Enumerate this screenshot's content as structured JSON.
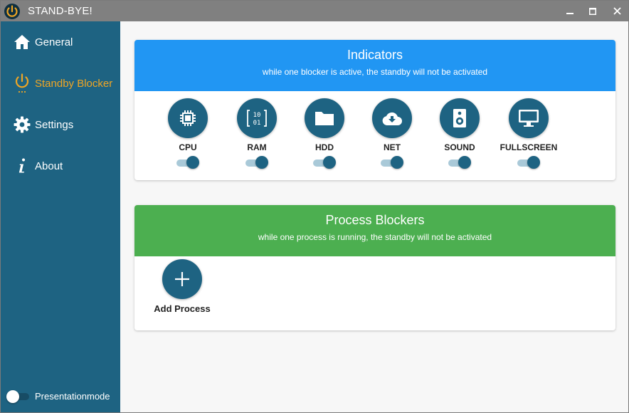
{
  "window": {
    "title": "STAND-BYE!"
  },
  "sidebar": {
    "items": [
      {
        "label": "General",
        "icon": "home-icon"
      },
      {
        "label": "Standby Blocker",
        "icon": "power-icon",
        "active": true
      },
      {
        "label": "Settings",
        "icon": "gear-icon"
      },
      {
        "label": "About",
        "icon": "info-icon"
      }
    ],
    "presentation_mode": {
      "label": "Presentationmode",
      "enabled": false
    }
  },
  "indicators": {
    "title": "Indicators",
    "subtitle": "while one blocker is active, the standby will not be activated",
    "items": [
      {
        "label": "CPU",
        "icon": "cpu-icon",
        "enabled": true
      },
      {
        "label": "RAM",
        "icon": "ram-icon",
        "enabled": true
      },
      {
        "label": "HDD",
        "icon": "folder-icon",
        "enabled": true
      },
      {
        "label": "NET",
        "icon": "cloud-download-icon",
        "enabled": true
      },
      {
        "label": "SOUND",
        "icon": "speaker-icon",
        "enabled": true
      },
      {
        "label": "FULLSCREEN",
        "icon": "monitor-icon",
        "enabled": true
      }
    ]
  },
  "process_blockers": {
    "title": "Process Blockers",
    "subtitle": "while one process is running, the standby will not be activated",
    "add_label": "Add Process"
  },
  "colors": {
    "sidebar": "#1e6382",
    "accent": "#f0a624",
    "indicators_header": "#2196f3",
    "process_header": "#4caf50"
  }
}
